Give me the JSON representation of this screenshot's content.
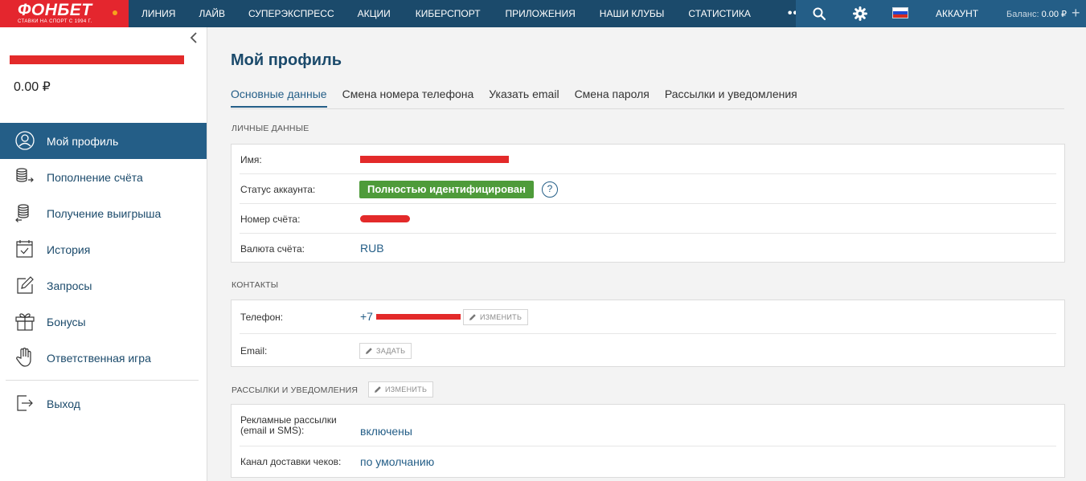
{
  "logo": {
    "brand": "ФОНБЕТ",
    "tagline": "СТАВКИ НА СПОРТ С 1994 Г."
  },
  "nav": {
    "items": [
      "ЛИНИЯ",
      "ЛАЙВ",
      "СУПЕРЭКСПРЕСС",
      "АКЦИИ",
      "КИБЕРСПОРТ",
      "ПРИЛОЖЕНИЯ",
      "НАШИ КЛУБЫ",
      "СТАТИСТИКА"
    ],
    "more": "•••"
  },
  "header": {
    "account_label": "АККАУНТ",
    "balance_label": "Баланс:",
    "balance_value": "0.00 ₽",
    "plus": "+"
  },
  "sidebar": {
    "balance": "0.00 ₽",
    "menu": [
      {
        "label": "Мой профиль",
        "icon": "user-icon"
      },
      {
        "label": "Пополнение счёта",
        "icon": "coins-deposit-icon"
      },
      {
        "label": "Получение выигрыша",
        "icon": "coins-withdraw-icon"
      },
      {
        "label": "История",
        "icon": "calendar-check-icon"
      },
      {
        "label": "Запросы",
        "icon": "edit-icon"
      },
      {
        "label": "Бонусы",
        "icon": "gift-icon"
      },
      {
        "label": "Ответственная игра",
        "icon": "hand-icon"
      }
    ],
    "logout": {
      "label": "Выход",
      "icon": "logout-icon"
    }
  },
  "main": {
    "title": "Мой профиль",
    "tabs": [
      "Основные данные",
      "Смена номера телефона",
      "Указать email",
      "Смена пароля",
      "Рассылки и уведомления"
    ],
    "personal": {
      "title": "ЛИЧНЫЕ ДАННЫЕ",
      "name_label": "Имя:",
      "status_label": "Статус аккаунта:",
      "status_value": "Полностью идентифицирован",
      "help": "?",
      "account_label": "Номер счёта:",
      "currency_label": "Валюта счёта:",
      "currency_value": "RUB"
    },
    "contacts": {
      "title": "КОНТАКТЫ",
      "phone_label": "Телефон:",
      "phone_prefix": "+7",
      "change_button": "ИЗМЕНИТЬ",
      "email_label": "Email:",
      "set_button": "ЗАДАТЬ"
    },
    "notifications": {
      "title": "РАССЫЛКИ И УВЕДОМЛЕНИЯ",
      "change_button": "ИЗМЕНИТЬ",
      "ads_label_line1": "Рекламные рассылки",
      "ads_label_line2": "(email и SMS):",
      "ads_value": "включены",
      "receipts_label": "Канал доставки чеков:",
      "receipts_value": "по умолчанию"
    }
  },
  "colors": {
    "brand_red": "#e4262e",
    "nav_bg": "#1b4a6b",
    "accent": "#245e87",
    "status_green": "#4e9b3a"
  }
}
